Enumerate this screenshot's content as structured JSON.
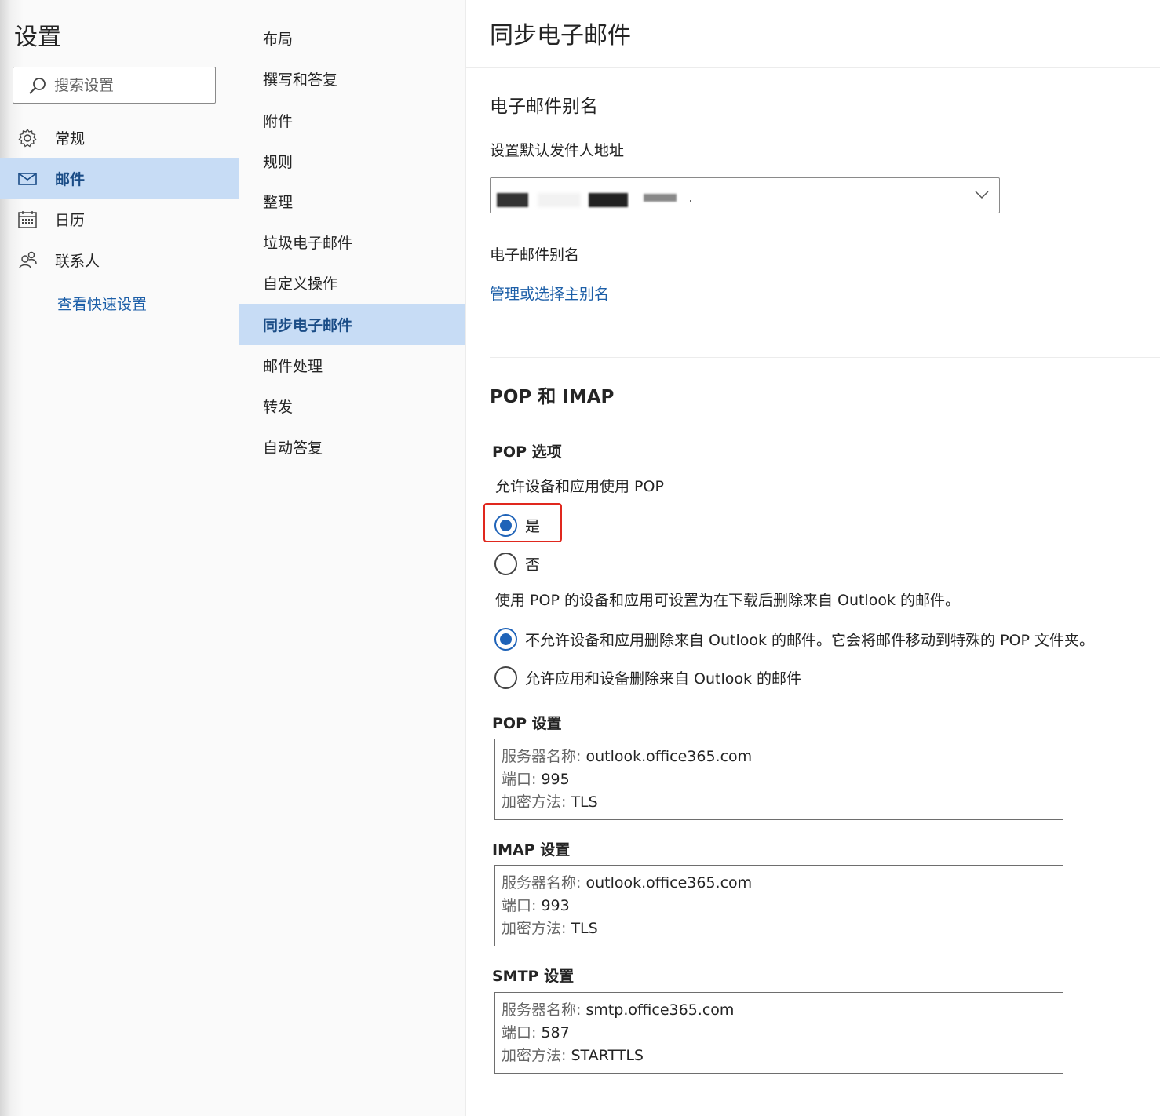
{
  "settings": {
    "title": "设置",
    "search_placeholder": "搜索设置"
  },
  "nav": {
    "items": [
      {
        "label": "常规",
        "icon": "gear-icon"
      },
      {
        "label": "邮件",
        "icon": "mail-icon",
        "active": true
      },
      {
        "label": "日历",
        "icon": "calendar-icon"
      },
      {
        "label": "联系人",
        "icon": "people-icon"
      }
    ],
    "quick_settings": "查看快速设置"
  },
  "subnav": {
    "items": [
      {
        "label": "布局"
      },
      {
        "label": "撰写和答复"
      },
      {
        "label": "附件"
      },
      {
        "label": "规则"
      },
      {
        "label": "整理"
      },
      {
        "label": "垃圾电子邮件"
      },
      {
        "label": "自定义操作"
      },
      {
        "label": "同步电子邮件",
        "active": true
      },
      {
        "label": "邮件处理"
      },
      {
        "label": "转发"
      },
      {
        "label": "自动答复"
      }
    ]
  },
  "main": {
    "title": "同步电子邮件",
    "alias_section": {
      "heading": "电子邮件别名",
      "default_sender_label": "设置默认发件人地址",
      "alias_label": "电子邮件别名",
      "manage_link": "管理或选择主别名"
    },
    "pop_imap": {
      "heading": "POP 和 IMAP",
      "pop_options_label": "POP 选项",
      "allow_pop_label": "允许设备和应用使用 POP",
      "yes_label": "是",
      "no_label": "否",
      "delete_note": "使用 POP 的设备和应用可设置为在下载后删除来自 Outlook 的邮件。",
      "dont_allow_delete_label": "不允许设备和应用删除来自 Outlook 的邮件。它会将邮件移动到特殊的 POP 文件夹。",
      "allow_delete_label": "允许应用和设备删除来自 Outlook 的邮件",
      "pop_settings": {
        "heading": "POP 设置",
        "server_key": "服务器名称:",
        "server": "outlook.office365.com",
        "port_key": "端口:",
        "port": "995",
        "enc_key": "加密方法:",
        "encryption": "TLS"
      },
      "imap_settings": {
        "heading": "IMAP 设置",
        "server_key": "服务器名称:",
        "server": "outlook.office365.com",
        "port_key": "端口:",
        "port": "993",
        "enc_key": "加密方法:",
        "encryption": "TLS"
      },
      "smtp_settings": {
        "heading": "SMTP 设置",
        "server_key": "服务器名称:",
        "server": "smtp.office365.com",
        "port_key": "端口:",
        "port": "587",
        "enc_key": "加密方法:",
        "encryption": "STARTTLS"
      }
    }
  },
  "colors": {
    "accent": "#1f63b8",
    "selected_bg": "#c7dcf5",
    "link": "#1d5fa8",
    "highlight": "#e0281e"
  }
}
